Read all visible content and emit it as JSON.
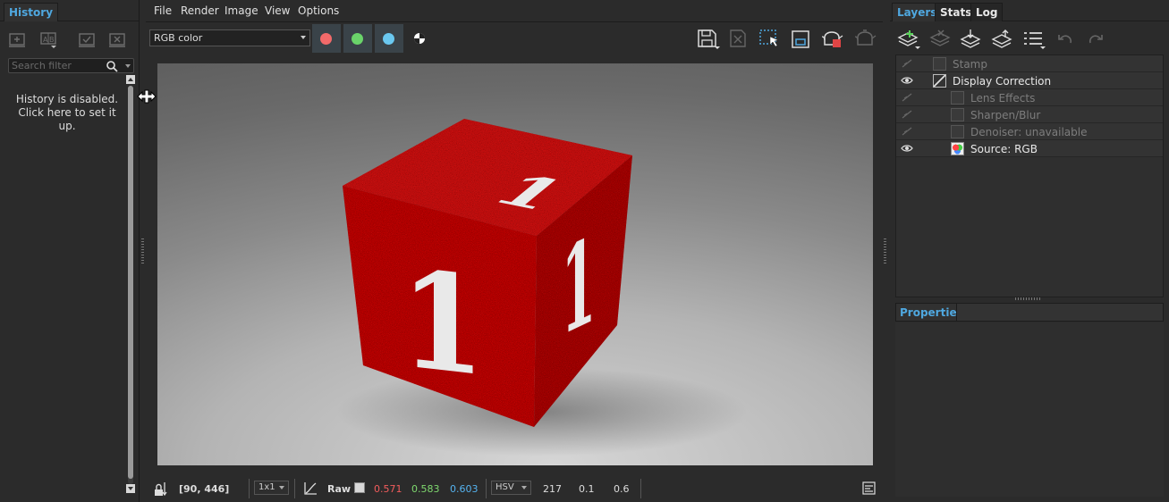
{
  "left_panel": {
    "tab": "History",
    "search_placeholder": "Search filter",
    "message_line1": "History is disabled.",
    "message_line2": "Click here to set it up.",
    "icons": [
      "add-snapshot-icon",
      "compare-ab-icon",
      "save-snapshot-icon",
      "delete-snapshot-icon"
    ]
  },
  "menu": {
    "file": "File",
    "render": "Render",
    "image": "Image",
    "view": "View",
    "options": "Options"
  },
  "toolbar": {
    "channel": "RGB color",
    "channel_colors": {
      "red": "#f26a6a",
      "green": "#6ad46a",
      "blue": "#6ac8f0"
    }
  },
  "viewport": {
    "cube_face_label": "1",
    "cube_color": "#d41414"
  },
  "statusbar": {
    "coords": "[90, 446]",
    "zoom": "1x1",
    "raw_label": "Raw",
    "r": "0.571",
    "g": "0.583",
    "b": "0.603",
    "color_space": "HSV",
    "h": "217",
    "s": "0.1",
    "v": "0.6",
    "value_colors": {
      "r": "#f25c5c",
      "g": "#7fd96f",
      "b": "#55b3f0"
    }
  },
  "right_panel": {
    "tabs": [
      "Layers",
      "Stats",
      "Log"
    ],
    "layers": [
      {
        "name": "Stamp",
        "visible": false,
        "indent": 0
      },
      {
        "name": "Display Correction",
        "visible": true,
        "indent": 0
      },
      {
        "name": "Lens Effects",
        "visible": false,
        "indent": 1
      },
      {
        "name": "Sharpen/Blur",
        "visible": false,
        "indent": 1
      },
      {
        "name": "Denoiser: unavailable",
        "visible": false,
        "indent": 1
      },
      {
        "name": "Source: RGB",
        "visible": true,
        "indent": 1
      }
    ],
    "properties_tab": "Properties"
  }
}
